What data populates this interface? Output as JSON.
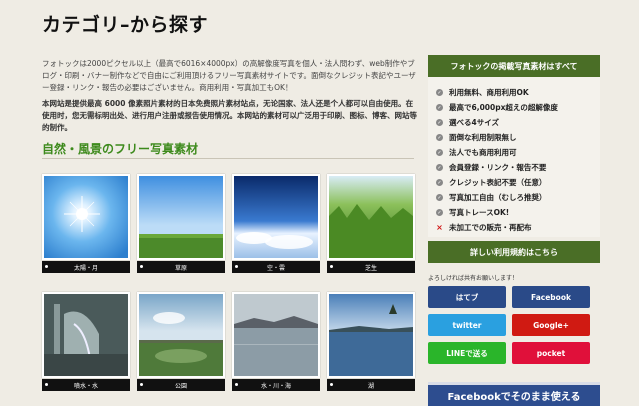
{
  "header": {
    "title": "カテゴリ–から探す"
  },
  "intro": {
    "jp": "フォトックは2000ピクセル以上（最高で6016×4000px）の高解像度写真を個人・法人問わず、web制作やブログ・印刷・バナー制作などで自由にご利用頂けるフリー写真素材サイトです。面倒なクレジット表記やユーザー登録・リンク・報告の必要はございません。商用利用・写真加工もOK！",
    "cn": "本网站是提供最高 6000 像素照片素材的日本免费照片素材站点，无论国家、法人还是个人都可以自由使用。在使用时，您无需标明出处、进行用户注册或报告使用情况。本网站的素材可以广泛用于印刷、图标、博客、网站等的制作。"
  },
  "section": {
    "title": "自然・風景のフリー写真素材"
  },
  "categories": [
    {
      "label": "太陽・月",
      "icon": "sun-photo"
    },
    {
      "label": "草原",
      "icon": "grassland-photo"
    },
    {
      "label": "空・雲",
      "icon": "sky-clouds-photo"
    },
    {
      "label": "芝生",
      "icon": "lawn-photo"
    },
    {
      "label": "噴水・水",
      "icon": "fountain-photo"
    },
    {
      "label": "公園",
      "icon": "park-photo"
    },
    {
      "label": "水・川・海",
      "icon": "water-river-sea-photo"
    },
    {
      "label": "湖",
      "icon": "lake-photo"
    }
  ],
  "sidebar": {
    "head": "フォトックの掲載写真素材はすべて",
    "features": [
      {
        "label": "利用無料、商用利用OK",
        "ok": true
      },
      {
        "label": "最高で6,000px超えの超解像度",
        "ok": true
      },
      {
        "label": "選べる4サイズ",
        "ok": true
      },
      {
        "label": "面倒な利用制限無し",
        "ok": true
      },
      {
        "label": "法人でも商用利用可",
        "ok": true
      },
      {
        "label": "会員登録・リンク・報告不要",
        "ok": true
      },
      {
        "label": "クレジット表記不要（任意）",
        "ok": true
      },
      {
        "label": "写真加工自由（むしろ推奨）",
        "ok": true
      },
      {
        "label": "写真トレースOK!",
        "ok": true
      },
      {
        "label": "未加工での販売・再配布",
        "ok": false
      }
    ],
    "terms_button": "詳しい利用規約はこちら",
    "share_note": "よろしければ共有お願いします！",
    "share_buttons": [
      {
        "label": "はてブ",
        "color": "#2a4a88"
      },
      {
        "label": "Facebook",
        "color": "#2a4a88"
      },
      {
        "label": "twitter",
        "color": "#2aa0e0"
      },
      {
        "label": "Google+",
        "color": "#d01a12"
      },
      {
        "label": "LINEで送る",
        "color": "#2ab52a"
      },
      {
        "label": "pocket",
        "color": "#e0103a"
      }
    ],
    "fb_banner": "Facebookでそのまま使える"
  },
  "colors": {
    "accent_green": "#4a6e26",
    "title_green": "#3d8a1c",
    "background": "#efece4"
  }
}
